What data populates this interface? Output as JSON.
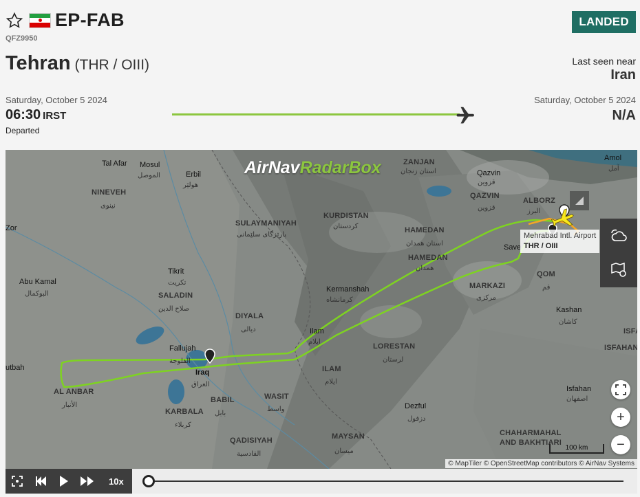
{
  "header": {
    "registration": "EP-FAB",
    "flight_number": "QFZ9950",
    "status": "LANDED",
    "country_flag": "iran-flag-icon"
  },
  "origin": {
    "city": "Tehran",
    "codes": "(THR / OIII)",
    "date": "Saturday, October 5 2024",
    "time": "06:30",
    "timezone": "IRST",
    "state": "Departed"
  },
  "last_seen": {
    "label": "Last seen near",
    "value": "Iran"
  },
  "arrival": {
    "date": "Saturday, October 5 2024",
    "time": "N/A"
  },
  "progress": 1.0,
  "map": {
    "logo_part1": "AirNav",
    "logo_part2": "RadarBox",
    "airport_popup": {
      "name": "Mehrabad Intl. Airport",
      "codes": "THR / OIII"
    },
    "scale_label": "100 km",
    "attribution": "© MapTiler © OpenStreetMap contributors © AirNav Systems",
    "labels": {
      "tal_afar": "Tal Afar",
      "mosul": "Mosul",
      "mosul_ar": "الموصل",
      "erbil": "Erbil",
      "erbil_ar": "هولێر",
      "nineveh": "NINEVEH",
      "nineveh_ar": "نينوى",
      "zanjan": "ZANJAN",
      "zanjan_ar": "استان زنجان",
      "qazvin_city": "Qazvin",
      "qazvin_city_ar": "قزوین",
      "qazvin": "QAZVIN",
      "qazvin_ar": "قزوین",
      "alborz": "ALBORZ",
      "alborz_ar": "البرز",
      "amol": "Amol",
      "amol_ar": "آمل",
      "kurdistan": "KURDISTAN",
      "kurdistan_ar": "کردستان",
      "sulaymaniyah": "SULAYMANIYAH",
      "sulaymaniyah_ar": "پارێزگای سلێمانی",
      "hamedan_prov": "HAMEDAN",
      "hamedan_prov_ar": "استان همدان",
      "hamedan": "HAMEDAN",
      "hamedan_ar": "همدان",
      "saveh": "Save",
      "zor": "Zor",
      "tikrit": "Tikrit",
      "tikrit_ar": "تكريت",
      "saladin": "SALADIN",
      "saladin_ar": "صلاح الدين",
      "abu_kamal": "Abu Kamal",
      "abu_kamal_ar": "البوكمال",
      "markazi": "MARKAZI",
      "markazi_ar": "مرکزی",
      "qom": "QOM",
      "qom_ar": "قم",
      "kermanshah": "Kermanshah",
      "kermanshah_ar": "کرمانشاه",
      "kashan": "Kashan",
      "kashan_ar": "کاشان",
      "diyala": "DIYALA",
      "diyala_ar": "ديالى",
      "ilam_city": "Ilam",
      "ilam_city_ar": "ایلام",
      "isfa": "ISFA",
      "fallujah": "Fallujah",
      "fallujah_ar": "الفلوجة",
      "iraq": "Iraq",
      "iraq_ar": "العراق",
      "lorestan": "LORESTAN",
      "lorestan_ar": "لرستان",
      "ilam": "ILAM",
      "ilam_ar": "ایلام",
      "isfahan_prov": "ISFAHAN",
      "isfahan": "Isfahan",
      "isfahan_ar": "اصفهان",
      "utbah": "utbah",
      "al_anbar": "AL ANBAR",
      "al_anbar_ar": "الأنبار",
      "babil": "BABIL",
      "babil_ar": "بابل",
      "wasit": "WASIT",
      "wasit_ar": "واسط",
      "dezful": "Dezful",
      "dezful_ar": "دزفول",
      "karbala": "KARBALA",
      "karbala_ar": "كربلاء",
      "chahar": "CHAHARMAHAL",
      "bakhtiari": "AND BAKHTIARI",
      "qadisiyah": "QADISIYAH",
      "qadisiyah_ar": "القادسية",
      "maysan": "MAYSAN",
      "maysan_ar": "ميسان"
    }
  },
  "playback": {
    "speed": "10x",
    "position": 0.0
  },
  "colors": {
    "status_bg": "#1f6e63",
    "track_green": "#7ed321",
    "track_orange": "#f5a623",
    "progress_green": "#8cc63f"
  }
}
